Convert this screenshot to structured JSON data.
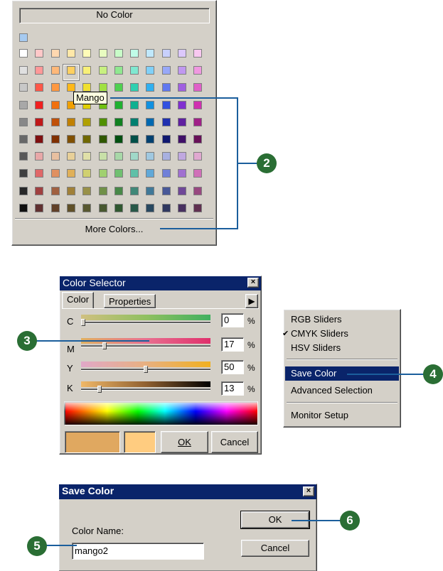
{
  "palette": {
    "no_color_label": "No Color",
    "more_colors_label": "More Colors...",
    "tooltip": "Mango",
    "extra_swatch": "#a6caf0",
    "rows": [
      [
        "#ffffff",
        "#ffc8c8",
        "#ffd8b0",
        "#ffe8a8",
        "#fffcb8",
        "#e8fcc0",
        "#c8fcc8",
        "#c0fce8",
        "#c0e8fc",
        "#c8d0fc",
        "#dcc8fc",
        "#f8c8f0"
      ],
      [
        "#e0e0e0",
        "#ff9898",
        "#ffb878",
        "#ffd060",
        "#f8f078",
        "#c8f080",
        "#90e890",
        "#80e8d0",
        "#80d0f8",
        "#98a8f8",
        "#c098f0",
        "#f098e0"
      ],
      [
        "#c8c8c8",
        "#ff5848",
        "#ff9840",
        "#ffb818",
        "#f0e030",
        "#a0e040",
        "#50d050",
        "#30d0b0",
        "#30b0f0",
        "#6078f0",
        "#a060e0",
        "#e060c8"
      ],
      [
        "#a8a8a8",
        "#f02020",
        "#f07010",
        "#f0a000",
        "#e0d000",
        "#70c010",
        "#20b030",
        "#10b090",
        "#1090e0",
        "#3050e0",
        "#8030d0",
        "#d030b0"
      ],
      [
        "#888888",
        "#c01818",
        "#c05008",
        "#c08000",
        "#b0a000",
        "#509000",
        "#108020",
        "#008070",
        "#0068b0",
        "#2030b0",
        "#6020a0",
        "#a02088"
      ],
      [
        "#686868",
        "#801010",
        "#803000",
        "#805000",
        "#706800",
        "#305800",
        "#005010",
        "#005048",
        "#004070",
        "#101870",
        "#401068",
        "#681058"
      ],
      [
        "#585858",
        "#e8a8a8",
        "#e8c0a0",
        "#e8d098",
        "#e0e0a8",
        "#c8e0a8",
        "#a8d8a8",
        "#a0d8c8",
        "#a0c8e0",
        "#a8b0e0",
        "#c0a8e0",
        "#e0a8d0"
      ],
      [
        "#404040",
        "#e06868",
        "#e09060",
        "#e0b058",
        "#d0d070",
        "#a0d070",
        "#70c070",
        "#60c0a8",
        "#60a8d8",
        "#7080d8",
        "#a070d0",
        "#d070b8"
      ],
      [
        "#282828",
        "#a04040",
        "#a06040",
        "#a08038",
        "#989048",
        "#709048",
        "#488848",
        "#408878",
        "#407898",
        "#485898",
        "#704898",
        "#984880"
      ],
      [
        "#101010",
        "#603030",
        "#604028",
        "#605028",
        "#585830",
        "#485830",
        "#305830",
        "#285848",
        "#284860",
        "#303860",
        "#483060",
        "#603050"
      ]
    ]
  },
  "callouts": {
    "c2": "2",
    "c3": "3",
    "c4": "4",
    "c5": "5",
    "c6": "6"
  },
  "color_selector": {
    "title": "Color Selector",
    "tab_color": "Color",
    "tab_properties": "Properties",
    "sliders": [
      {
        "label": "C",
        "value": "0",
        "pct": "%",
        "level": 0
      },
      {
        "label": "M",
        "value": "17",
        "pct": "%",
        "level": 17
      },
      {
        "label": "Y",
        "value": "50",
        "pct": "%",
        "level": 50
      },
      {
        "label": "K",
        "value": "13",
        "pct": "%",
        "level": 13
      }
    ],
    "current_color": "#e0a860",
    "new_color": "#ffcc80",
    "ok_label": "OK",
    "cancel_label": "Cancel"
  },
  "context_menu": {
    "items": [
      {
        "label": "RGB Sliders",
        "checked": false
      },
      {
        "label": "CMYK Sliders",
        "checked": true
      },
      {
        "label": "HSV Sliders",
        "checked": false
      },
      {
        "label": "Save Color",
        "checked": false
      },
      {
        "label": "Advanced Selection",
        "checked": false
      },
      {
        "label": "Monitor Setup",
        "checked": false
      }
    ],
    "check_mark": "✔"
  },
  "save_dialog": {
    "title": "Save Color",
    "name_label": "Color Name:",
    "name_value": "mango2",
    "ok_label": "OK",
    "cancel_label": "Cancel"
  }
}
